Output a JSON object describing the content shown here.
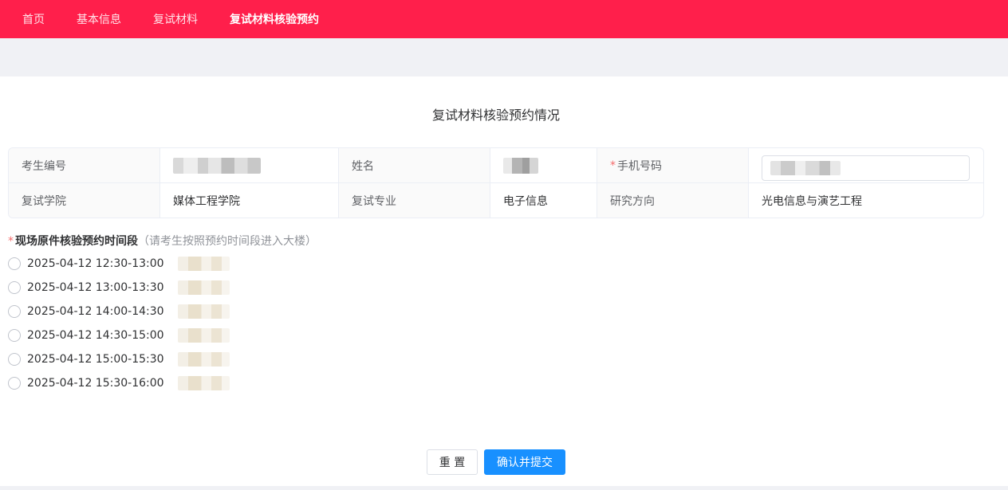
{
  "nav": {
    "items": [
      {
        "label": "首页"
      },
      {
        "label": "基本信息"
      },
      {
        "label": "复试材料"
      },
      {
        "label": "复试材料核验预约"
      }
    ],
    "active_index": 3
  },
  "page": {
    "title": "复试材料核验预约情况"
  },
  "info": {
    "exam_no_label": "考生编号",
    "name_label": "姓名",
    "phone_label": "手机号码",
    "college_label": "复试学院",
    "college_value": "媒体工程学院",
    "major_label": "复试专业",
    "major_value": "电子信息",
    "direction_label": "研究方向",
    "direction_value": "光电信息与演艺工程"
  },
  "appointment": {
    "label": "现场原件核验预约时间段",
    "hint": "（请考生按照预约时间段进入大楼）",
    "required_mark": "*",
    "slots": [
      {
        "time": "2025-04-12 12:30-13:00"
      },
      {
        "time": "2025-04-12 13:00-13:30"
      },
      {
        "time": "2025-04-12 14:00-14:30"
      },
      {
        "time": "2025-04-12 14:30-15:00"
      },
      {
        "time": "2025-04-12 15:00-15:30"
      },
      {
        "time": "2025-04-12 15:30-16:00"
      }
    ]
  },
  "buttons": {
    "reset": "重 置",
    "submit": "确认并提交"
  },
  "colors": {
    "brand": "#ff1f4b",
    "primary": "#1890ff",
    "required": "#f56c6c"
  }
}
